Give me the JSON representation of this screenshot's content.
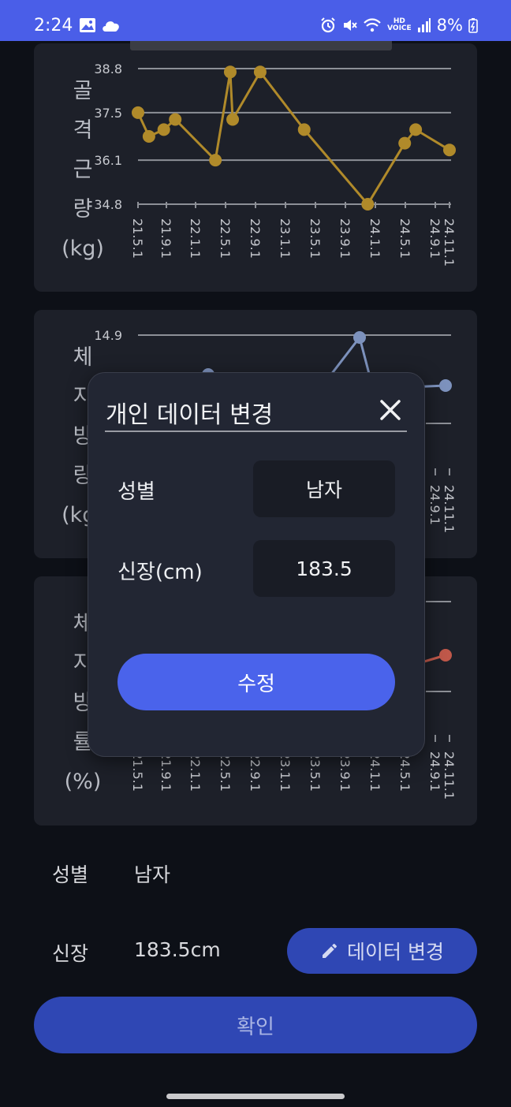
{
  "status_bar": {
    "time": "2:24",
    "battery": "8%"
  },
  "charts": [
    {
      "label_chars": [
        "골",
        "격",
        "근",
        "량",
        "(kg)"
      ],
      "chart_data": {
        "type": "line",
        "color": "#b08a2a",
        "y_ticks": [
          "38.8",
          "37.5",
          "36.1",
          "34.8"
        ],
        "ylim": [
          34.8,
          38.8
        ],
        "x_ticks": [
          "21.5.1",
          "21.9.1",
          "22.1.1",
          "22.5.1",
          "22.9.1",
          "23.1.1",
          "23.5.1",
          "23.9.1",
          "24.1.1",
          "24.5.1",
          "24.9.1",
          "24.11.1"
        ],
        "points": [
          [
            "2021-05-01",
            37.5
          ],
          [
            "2021-06-15",
            36.8
          ],
          [
            "2021-08-15",
            37.0
          ],
          [
            "2021-10-01",
            37.3
          ],
          [
            "2022-03-15",
            36.1
          ],
          [
            "2022-05-15",
            38.7
          ],
          [
            "2022-05-25",
            37.3
          ],
          [
            "2022-09-15",
            38.7
          ],
          [
            "2023-03-15",
            37.0
          ],
          [
            "2023-12-01",
            34.8
          ],
          [
            "2024-05-01",
            36.6
          ],
          [
            "2024-06-15",
            37.0
          ],
          [
            "2024-11-01",
            36.4
          ]
        ]
      }
    },
    {
      "label_chars": [
        "체",
        "지",
        "방",
        "량",
        "(kg)"
      ],
      "chart_data": {
        "type": "line",
        "color": "#7d92bd",
        "y_ticks": [
          "14.9"
        ],
        "x_ticks": [
          "24.9.1",
          "24.11.1"
        ],
        "points": [
          [
            "2023-12-01",
            14.9
          ],
          [
            "2024-11-01",
            14.0
          ]
        ]
      }
    },
    {
      "label_chars": [
        "체",
        "지",
        "방",
        "률",
        "(%)"
      ],
      "chart_data": {
        "type": "line",
        "color": "#c0584a",
        "x_ticks": [
          "21.5.1",
          "21.9.1",
          "22.1.1",
          "22.5.1",
          "22.9.1",
          "23.1.1",
          "23.5.1",
          "23.9.1",
          "24.1.1",
          "24.5.1",
          "24.9.1",
          "24.11.1"
        ],
        "points": [
          [
            "2024-11-01",
            null
          ]
        ]
      }
    }
  ],
  "info": {
    "gender_label": "성별",
    "gender_value": "남자",
    "height_label": "신장",
    "height_value": "183.5cm",
    "data_change_button": "데이터 변경"
  },
  "confirm_button": "확인",
  "dialog": {
    "title": "개인 데이터 변경",
    "gender_label": "성별",
    "gender_value": "남자",
    "height_label": "신장(cm)",
    "height_value": "183.5",
    "submit": "수정"
  },
  "colors": {
    "accent": "#4a63eb",
    "status_bar": "#4a5ee8",
    "card": "#1d2029"
  }
}
